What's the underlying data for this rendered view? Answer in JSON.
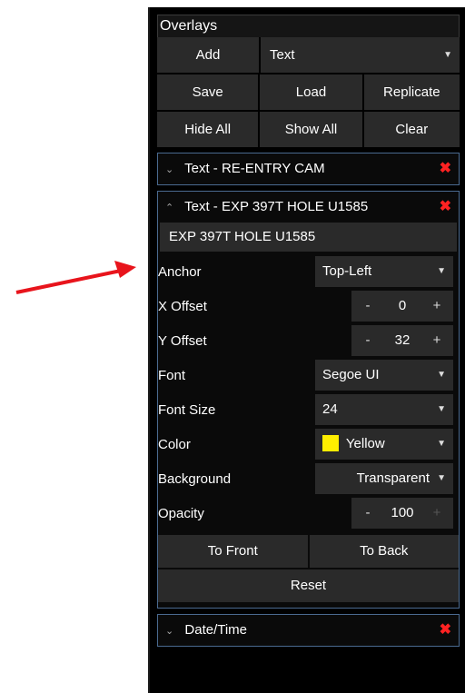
{
  "panel": {
    "title": "Overlays",
    "add_label": "Add",
    "type_select": "Text",
    "save_label": "Save",
    "load_label": "Load",
    "replicate_label": "Replicate",
    "hide_all_label": "Hide All",
    "show_all_label": "Show All",
    "clear_label": "Clear"
  },
  "sections": {
    "collapsed_top": {
      "title": "Text - RE-ENTRY CAM"
    },
    "expanded": {
      "title": "Text - EXP 397T HOLE U1585",
      "text_value": "EXP 397T HOLE U1585",
      "anchor_label": "Anchor",
      "anchor_value": "Top-Left",
      "x_offset_label": "X Offset",
      "x_offset_value": "0",
      "y_offset_label": "Y Offset",
      "y_offset_value": "32",
      "font_label": "Font",
      "font_value": "Segoe UI",
      "font_size_label": "Font Size",
      "font_size_value": "24",
      "color_label": "Color",
      "color_value": "Yellow",
      "color_hex": "#ffee00",
      "background_label": "Background",
      "background_value": "Transparent",
      "opacity_label": "Opacity",
      "opacity_value": "100",
      "to_front_label": "To Front",
      "to_back_label": "To Back",
      "reset_label": "Reset"
    },
    "collapsed_bottom": {
      "title": "Date/Time"
    }
  },
  "stepper": {
    "minus": "-",
    "plus": "+"
  },
  "icons": {
    "close": "✖",
    "chevron_down": "⌄",
    "chevron_up": "⌃",
    "caret": "▼"
  },
  "annotation": {
    "arrow_color": "#e8141c"
  }
}
